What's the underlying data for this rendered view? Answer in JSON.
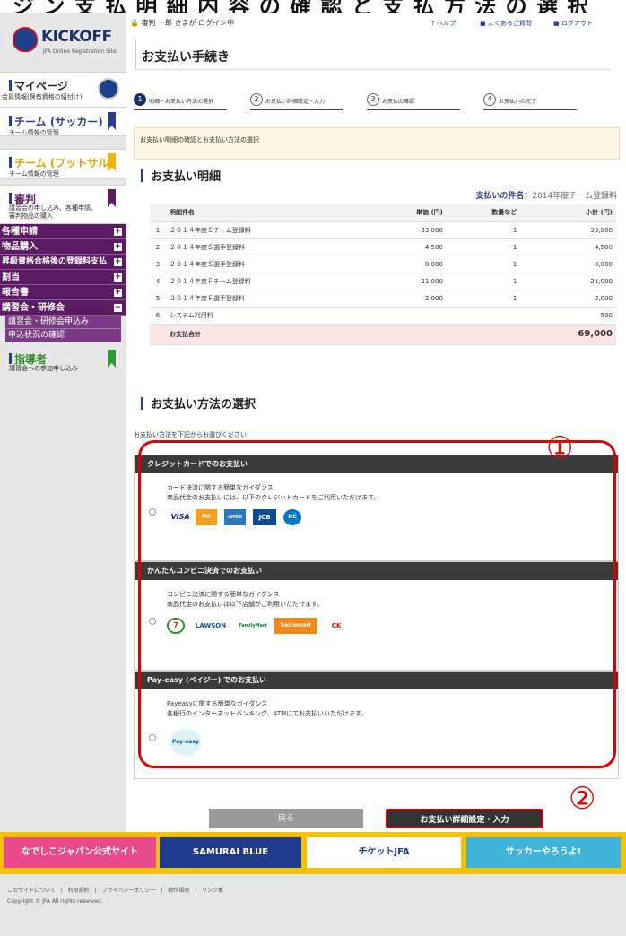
{
  "top_caption": "ジ ン 支 払 明 細 内 容 の 確 認 と 支 払 方 法 の 選 択",
  "logo": {
    "title": "KICKOFF",
    "subtitle": "JFA Online Registration Site"
  },
  "sidebar": {
    "mypage": {
      "title": "マイページ",
      "sub": "会員情報(保有資格の紹付け)"
    },
    "team_soccer": {
      "title": "チーム (サッカー)",
      "sub": "チーム情報の管理"
    },
    "team_futsal": {
      "title": "チーム (フットサル)",
      "sub": "チーム情報の管理"
    },
    "referee": {
      "title": "審判",
      "sub1": "講習会の申し込み、各種申請、",
      "sub2": "審判物品の購入"
    },
    "menu": [
      "各種申請",
      "物品購入",
      "昇級資格合格後の登録料支払",
      "割当",
      "報告書",
      "講習会・研修会"
    ],
    "submenu": [
      "講習会・研修会申込み",
      "申込状況の確認"
    ],
    "coach": {
      "title": "指導者",
      "sub": "講習会への参加申し込み"
    }
  },
  "header": {
    "login": "審判 一郎 さまが ログイン中",
    "help": "ヘルプ",
    "faq": "よくあるご質問",
    "logout": "ログアウト"
  },
  "page_title": "お支払い手続き",
  "steps": [
    {
      "n": "1",
      "label": "明細・お支払い方法の選択"
    },
    {
      "n": "2",
      "label": "お支払い詳細設定・入力"
    },
    {
      "n": "3",
      "label": "お支払の確認"
    },
    {
      "n": "4",
      "label": "お支払いの完了"
    }
  ],
  "note": "お支払い明細の確認とお支払い方法の選択",
  "statement": {
    "heading": "お支払い明細",
    "subject_label": "支払いの件名：",
    "subject_value": "2014年度チーム登録料",
    "columns": [
      "明細件名",
      "単価 (円)",
      "数量など",
      "小計 (円)"
    ],
    "rows": [
      {
        "no": "1",
        "name": "２０１４年度Ｓチーム登録料",
        "price": "33,000",
        "qty": "1",
        "sub": "33,000"
      },
      {
        "no": "2",
        "name": "２０１４年度Ｓ選手登録料",
        "price": "4,500",
        "qty": "1",
        "sub": "4,500"
      },
      {
        "no": "3",
        "name": "２０１４年度Ｓ選手登録料",
        "price": "8,000",
        "qty": "1",
        "sub": "8,000"
      },
      {
        "no": "4",
        "name": "２０１４年度Ｆチーム登録料",
        "price": "21,000",
        "qty": "1",
        "sub": "21,000"
      },
      {
        "no": "5",
        "name": "２０１４年度Ｆ選手登録料",
        "price": "2,000",
        "qty": "1",
        "sub": "2,000"
      },
      {
        "no": "6",
        "name": "システム利用料",
        "price": "",
        "qty": "",
        "sub": "500"
      }
    ],
    "total_label": "お支払合計",
    "total": "69,000"
  },
  "payment": {
    "heading": "お支払い方法の選択",
    "instruction": "お支払い方法を下記からお選びください",
    "methods": [
      {
        "header": "クレジットカードでのお支払い",
        "line1": "カード決済に関する簡単なガイダンス",
        "line2": "商品代金のお支払いには、以下のクレジットカードをご利用いただけます。",
        "logos": [
          "VISA",
          "MC",
          "AMEX",
          "JCB",
          "DC"
        ]
      },
      {
        "header": "かんたんコンビニ決済でのお支払い",
        "line1": "コンビニ決済に関する簡単なガイダンス",
        "line2": "商品代金のお支払いは以下店舗がご利用いただけます。",
        "logos": [
          "7",
          "LAWSON",
          "FamilyMart",
          "Seicomart",
          "CK"
        ]
      },
      {
        "header": "Pay-easy (ペイジー) でのお支払い",
        "line1": "Payeasyに関する簡単なガイダンス",
        "line2": "各銀行のインターネットバンキング、ATMにてお支払いいただけます。",
        "logos": [
          "Pay-easy"
        ]
      }
    ]
  },
  "annotations": {
    "one": "①",
    "two": "②"
  },
  "buttons": {
    "back": "戻る",
    "next": "お支払い詳細設定・入力"
  },
  "banners": [
    "なでしこジャパン公式サイト",
    "SAMURAI BLUE",
    "チケットJFA",
    "サッカーやろうよ!"
  ],
  "footer": {
    "links": "このサイトについて | 利用規約 | プライバシーポリシー | 動作環境 | リンク集",
    "copyright": "Copyright © JFA All rights reserved."
  }
}
